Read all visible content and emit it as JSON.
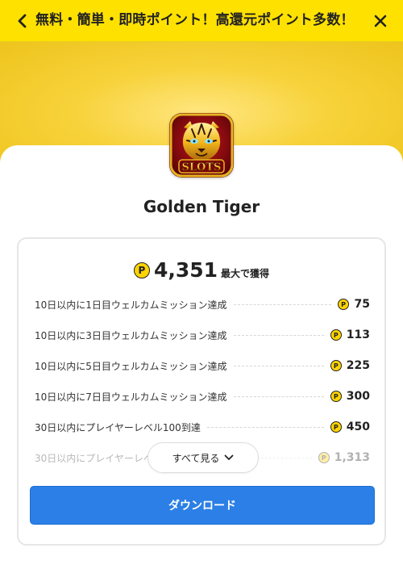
{
  "header": {
    "title": "無料・簡単・即時ポイント！高還元ポイント多数！",
    "back_icon": "chevron-left-icon",
    "close_icon": "close-icon"
  },
  "app": {
    "name": "Golden Tiger",
    "icon_text": "SLOTS",
    "icon": "golden-tiger-slots-icon"
  },
  "points": {
    "coin_symbol": "P",
    "total": "4,351",
    "total_suffix": "最大で獲得"
  },
  "missions": [
    {
      "label": "10日以内に1日目ウェルカムミッション達成",
      "reward": "75"
    },
    {
      "label": "10日以内に3日目ウェルカムミッション達成",
      "reward": "113"
    },
    {
      "label": "10日以内に5日目ウェルカムミッション達成",
      "reward": "225"
    },
    {
      "label": "10日以内に7日目ウェルカムミッション達成",
      "reward": "300"
    },
    {
      "label": "30日以内にプレイヤーレベル100到達",
      "reward": "450"
    },
    {
      "label": "30日以内にプレイヤーレベ",
      "reward": "1,313"
    }
  ],
  "buttons": {
    "see_all": "すべて見る",
    "download": "ダウンロード"
  },
  "colors": {
    "header_bg": "#ffe100",
    "hero_bg": "#f7d23a",
    "coin": "#ffd400",
    "primary_button": "#2b7fe6"
  }
}
